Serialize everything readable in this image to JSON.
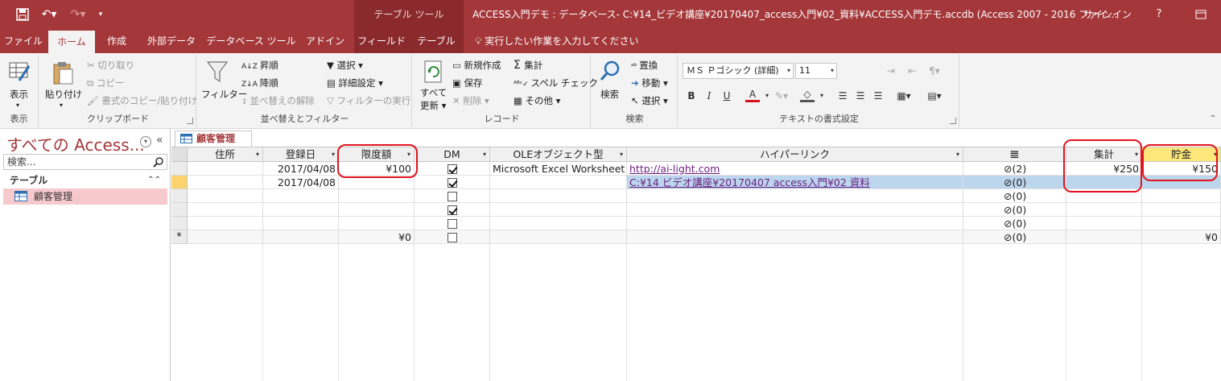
{
  "titlebar": {
    "context_tool": "テーブル ツール",
    "title": "ACCESS入門デモ : データベース- C:¥14_ビデオ講座¥20170407_access入門¥02_資料¥ACCESS入門デモ.accdb (Access 2007 - 2016 ファイ…",
    "signin": "サインイン",
    "help": "?"
  },
  "tabs": [
    {
      "label": "ファイル"
    },
    {
      "label": "ホーム"
    },
    {
      "label": "作成"
    },
    {
      "label": "外部データ"
    },
    {
      "label": "データベース ツール"
    },
    {
      "label": "アドイン"
    },
    {
      "label": "フィールド"
    },
    {
      "label": "テーブル"
    }
  ],
  "tellme": "実行したい作業を入力してください",
  "ribbon": {
    "view": {
      "label": "表示",
      "group": "表示"
    },
    "clipboard": {
      "paste": "貼り付け",
      "cut": "切り取り",
      "copy": "コピー",
      "format_painter": "書式のコピー/貼り付け",
      "group": "クリップボード"
    },
    "sort": {
      "filter": "フィルター",
      "asc": "昇順",
      "desc": "降順",
      "clear": "並べ替えの解除",
      "select": "選択",
      "advanced": "詳細設定",
      "toggle": "フィルターの実行",
      "group": "並べ替えとフィルター"
    },
    "records": {
      "refresh1": "すべて",
      "refresh2": "更新",
      "new": "新規作成",
      "save": "保存",
      "delete": "削除",
      "totals": "集計",
      "spell": "スペル チェック",
      "more": "その他",
      "group": "レコード"
    },
    "find": {
      "find": "検索",
      "replace": "置換",
      "goto": "移動",
      "select": "選択",
      "group": "検索"
    },
    "text": {
      "font": "ＭＳ Ｐゴシック (詳細)",
      "size": "11",
      "bold": "B",
      "italic": "I",
      "underline": "U",
      "group": "テキストの書式設定"
    }
  },
  "nav": {
    "title": "すべての Access...",
    "search_placeholder": "検索...",
    "section": "テーブル",
    "item": "顧客管理"
  },
  "document": {
    "tab": "顧客管理",
    "columns": [
      "住所",
      "登録日",
      "限度額",
      "DM",
      "OLEオブジェクト型",
      "ハイパーリンク",
      "",
      "集計",
      "貯金"
    ],
    "rows": [
      {
        "addr": "",
        "date": "2017/04/08",
        "limit": "¥100",
        "dm": true,
        "ole": "Microsoft Excel Worksheet",
        "link": "http://ai-light.com",
        "att": "(2)",
        "total": "¥250",
        "savings": "¥150"
      },
      {
        "addr": "",
        "date": "2017/04/08",
        "limit": "",
        "dm": true,
        "ole": "",
        "link": "C:¥14 ビデオ講座¥20170407 access入門¥02 資料",
        "att": "(0)",
        "total": "",
        "savings": ""
      },
      {
        "addr": "",
        "date": "",
        "limit": "",
        "dm": false,
        "ole": "",
        "link": "",
        "att": "(0)",
        "total": "",
        "savings": ""
      },
      {
        "addr": "",
        "date": "",
        "limit": "",
        "dm": true,
        "ole": "",
        "link": "",
        "att": "(0)",
        "total": "",
        "savings": ""
      },
      {
        "addr": "",
        "date": "",
        "limit": "",
        "dm": false,
        "ole": "",
        "link": "",
        "att": "(0)",
        "total": "",
        "savings": ""
      }
    ],
    "new_row": {
      "marker": "*",
      "limit": "¥0",
      "att": "(0)",
      "savings": "¥0"
    }
  },
  "colors": {
    "accent": "#a4373a",
    "annotation": "#e0141e",
    "selected_header": "#fde67a",
    "current_row": "#bcd6ee"
  }
}
